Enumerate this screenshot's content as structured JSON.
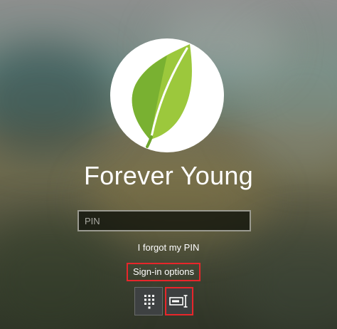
{
  "user": {
    "name": "Forever Young",
    "avatar_icon": "green-leaf"
  },
  "pin_input": {
    "placeholder": "PIN",
    "value": ""
  },
  "links": {
    "forgot_pin": "I forgot my PIN",
    "signin_options": "Sign-in options"
  },
  "signin_methods": [
    {
      "name": "PIN",
      "icon": "keypad-icon",
      "selected": false
    },
    {
      "name": "Password",
      "icon": "password-key-icon",
      "selected": true
    }
  ],
  "colors": {
    "highlight": "#e8262b",
    "leaf_light": "#9cc83c",
    "leaf_dark": "#6ea52d",
    "text": "#ffffff"
  }
}
